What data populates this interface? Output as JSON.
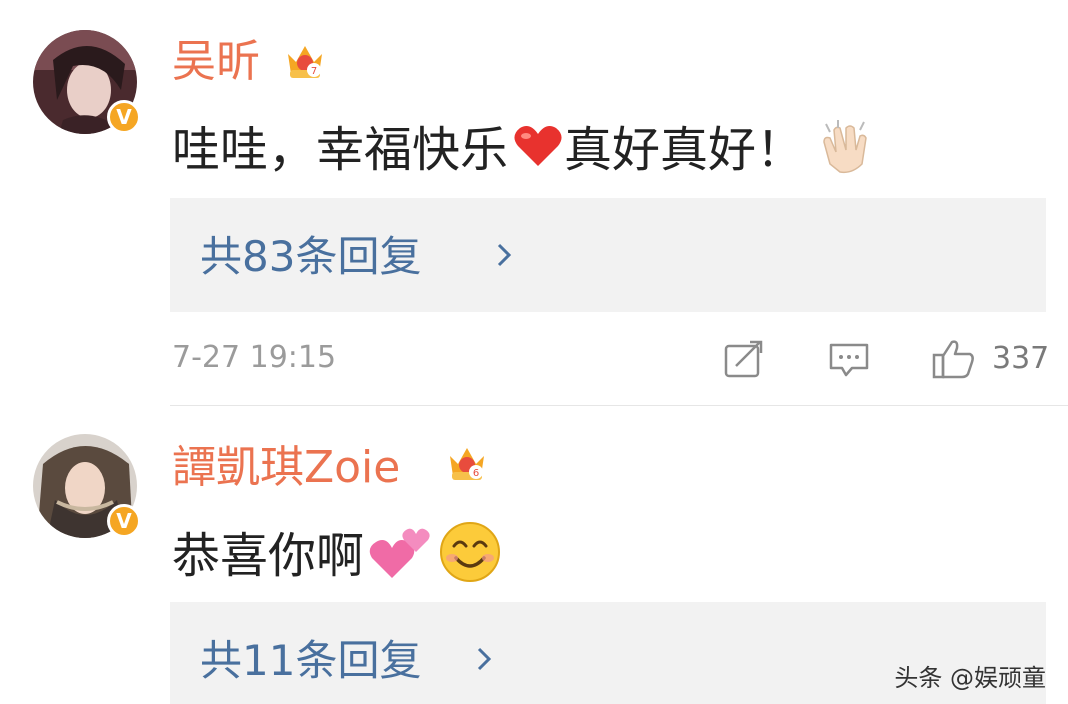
{
  "comments": [
    {
      "username": "吴昕",
      "crown_level": "7",
      "text": "哇哇，幸福快乐",
      "text_after_heart": "真好真好！",
      "reply_link": "共83条回复",
      "timestamp": "7-27 19:15",
      "likes": "337"
    },
    {
      "username": "譚凱琪Zoie",
      "crown_level": "6",
      "text": "恭喜你啊",
      "reply_link": "共11条回复"
    }
  ],
  "badge_letter": "V",
  "colors": {
    "username": "#eb7350",
    "reply_link": "#49709e",
    "reply_bg": "#f2f2f2",
    "meta": "#9b9b9b",
    "verified_badge": "#f5a623"
  },
  "icons": [
    "verified-badge-icon",
    "crown-icon",
    "heart-emoji-icon",
    "clap-emoji-icon",
    "two-hearts-emoji-icon",
    "smile-emoji-icon",
    "chevron-right-icon",
    "repost-icon",
    "comment-icon",
    "like-icon"
  ],
  "watermark": "头条 @娱顽童"
}
